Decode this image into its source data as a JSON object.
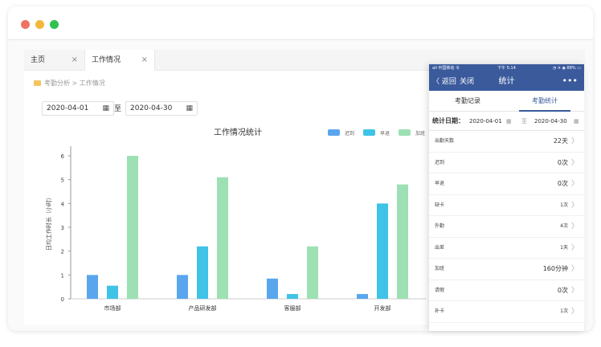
{
  "tabs": [
    {
      "label": "主页",
      "close": "×"
    },
    {
      "label": "工作情况",
      "close": "×"
    }
  ],
  "breadcrumb": {
    "root": "考勤分析",
    "sep": ">",
    "current": "工作情况"
  },
  "filters": {
    "start": "2020-04-01",
    "separator": "至",
    "end": "2020-04-30",
    "calendar_glyph": "▦"
  },
  "chart_data": {
    "type": "bar",
    "title": "工作情况统计",
    "ylabel": "日均工作时长（小时）",
    "xlabel": "",
    "ylim": [
      0,
      6
    ],
    "yticks": [
      "0",
      "1",
      "2",
      "3",
      "4",
      "5",
      "6"
    ],
    "categories": [
      "市场部",
      "产品研发部",
      "客服部",
      "开发部"
    ],
    "series": [
      {
        "name": "迟到",
        "color": "#5aa6ee",
        "values": [
          1.0,
          1.0,
          0.85,
          0.2
        ]
      },
      {
        "name": "早退",
        "color": "#3fc3e6",
        "values": [
          0.55,
          2.2,
          0.2,
          4.0
        ]
      },
      {
        "name": "加班",
        "color": "#9de0b4",
        "values": [
          6.0,
          5.1,
          2.2,
          4.8
        ]
      }
    ],
    "legend_position": "top-right",
    "grid": false
  },
  "phone": {
    "status_left": "all 中国移动 令",
    "status_time": "下午 5:14",
    "status_right": "◔ ✈ ◉ 88% ▭",
    "back_label": "〈 返回",
    "close_label": "关闭",
    "title": "统计",
    "more": "•••",
    "segments": [
      "考勤记录",
      "考勤统计"
    ],
    "filter_label": "统计日期：",
    "filter_start": "2020-04-01",
    "filter_sep": "至",
    "filter_end": "2020-04-30",
    "calendar_glyph": "▦",
    "rows": [
      {
        "label": "出勤天数",
        "value": "22天"
      },
      {
        "label": "迟到",
        "value": "0次"
      },
      {
        "label": "早退",
        "value": "0次"
      },
      {
        "label": "缺卡",
        "value": "1次"
      },
      {
        "label": "外勤",
        "value": "4次"
      },
      {
        "label": "出差",
        "value": "1天"
      },
      {
        "label": "加班",
        "value": "160分钟"
      },
      {
        "label": "请假",
        "value": "0次"
      },
      {
        "label": "补卡",
        "value": "1次"
      }
    ],
    "chevron": "〉"
  }
}
